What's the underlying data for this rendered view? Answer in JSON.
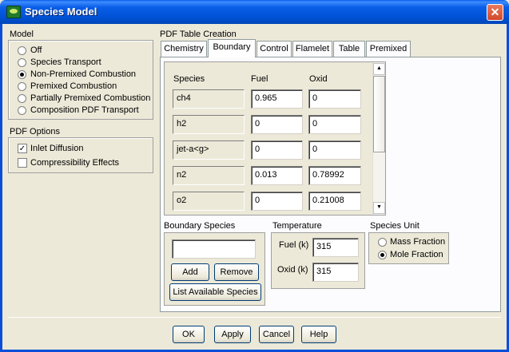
{
  "window": {
    "title": "Species Model",
    "close_glyph": "✕"
  },
  "model": {
    "label": "Model",
    "options": [
      {
        "label": "Off",
        "selected": false
      },
      {
        "label": "Species Transport",
        "selected": false
      },
      {
        "label": "Non-Premixed Combustion",
        "selected": true
      },
      {
        "label": "Premixed Combustion",
        "selected": false
      },
      {
        "label": "Partially Premixed Combustion",
        "selected": false
      },
      {
        "label": "Composition PDF Transport",
        "selected": false
      }
    ]
  },
  "pdf_options": {
    "label": "PDF Options",
    "items": [
      {
        "label": "Inlet Diffusion",
        "checked": true
      },
      {
        "label": "Compressibility Effects",
        "checked": false
      }
    ]
  },
  "pdf_table": {
    "label": "PDF Table Creation",
    "tabs": [
      "Chemistry",
      "Boundary",
      "Control",
      "Flamelet",
      "Table",
      "Premixed"
    ],
    "active_tab": "Boundary"
  },
  "boundary_table": {
    "headers": {
      "species": "Species",
      "fuel": "Fuel",
      "oxid": "Oxid"
    },
    "rows": [
      {
        "species": "ch4",
        "fuel": "0.965",
        "oxid": "0"
      },
      {
        "species": "h2",
        "fuel": "0",
        "oxid": "0"
      },
      {
        "species": "jet-a<g>",
        "fuel": "0",
        "oxid": "0"
      },
      {
        "species": "n2",
        "fuel": "0.013",
        "oxid": "0.78992"
      },
      {
        "species": "o2",
        "fuel": "0",
        "oxid": "0.21008"
      }
    ]
  },
  "boundary_species": {
    "label": "Boundary Species",
    "value": "",
    "add": "Add",
    "remove": "Remove",
    "list": "List Available Species"
  },
  "temperature": {
    "label": "Temperature",
    "fuel_label": "Fuel (k)",
    "fuel_value": "315",
    "oxid_label": "Oxid (k)",
    "oxid_value": "315"
  },
  "species_unit": {
    "label": "Species Unit",
    "options": [
      {
        "label": "Mass Fraction",
        "selected": false
      },
      {
        "label": "Mole Fraction",
        "selected": true
      }
    ]
  },
  "footer": {
    "ok": "OK",
    "apply": "Apply",
    "cancel": "Cancel",
    "help": "Help"
  }
}
